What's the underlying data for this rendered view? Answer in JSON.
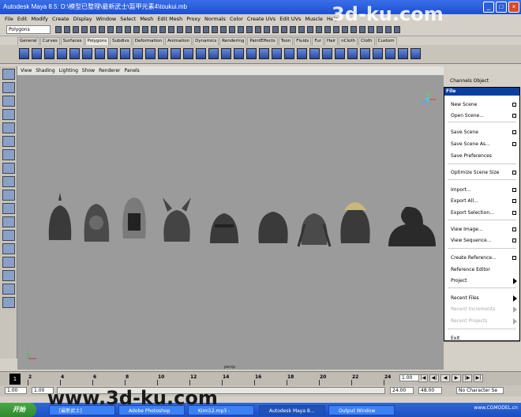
{
  "window": {
    "title": "Autodesk Maya 8.5: D:\\模型已整理\\最新武士\\盔甲元素4\\toukui.mb"
  },
  "menubar": [
    "File",
    "Edit",
    "Modify",
    "Create",
    "Display",
    "Window",
    "Select",
    "Mesh",
    "Edit Mesh",
    "Proxy",
    "Normals",
    "Color",
    "Create UVs",
    "Edit UVs",
    "Muscle",
    "Help"
  ],
  "mode": "Polygons",
  "shelf_tabs": [
    "General",
    "Curves",
    "Surfaces",
    "Polygons",
    "Subdivs",
    "Deformation",
    "Animation",
    "Dynamics",
    "Rendering",
    "PaintEffects",
    "Toon",
    "Fluids",
    "Fur",
    "Hair",
    "nCloth",
    "Cloth",
    "Custom"
  ],
  "viewport_menu": [
    "View",
    "Shading",
    "Lighting",
    "Show",
    "Renderer",
    "Panels"
  ],
  "viewport_label": "persp",
  "channel_box": "Channels Object",
  "file_menu": {
    "title": "File",
    "items": [
      {
        "label": "New Scene",
        "option": true
      },
      {
        "label": "Open Scene...",
        "option": true
      },
      {
        "label": "Save Scene",
        "option": true
      },
      {
        "label": "Save Scene As...",
        "option": true
      },
      {
        "label": "Save Preferences"
      },
      {
        "label": "Optimize Scene Size",
        "option": true
      },
      {
        "label": "Import...",
        "option": true
      },
      {
        "label": "Export All...",
        "option": true
      },
      {
        "label": "Export Selection...",
        "option": true
      },
      {
        "label": "View Image...",
        "option": true
      },
      {
        "label": "View Sequence...",
        "option": true
      },
      {
        "label": "Create Reference...",
        "option": true
      },
      {
        "label": "Reference Editor"
      },
      {
        "label": "Project",
        "submenu": true
      },
      {
        "label": "Recent Files",
        "submenu": true
      },
      {
        "label": "Recent Increments",
        "submenu": true,
        "disabled": true
      },
      {
        "label": "Recent Projects",
        "submenu": true,
        "disabled": true
      },
      {
        "label": "Exit"
      }
    ]
  },
  "timeline": {
    "frames": [
      "2",
      "4",
      "6",
      "8",
      "10",
      "12",
      "14",
      "16",
      "18",
      "20",
      "22",
      "24"
    ],
    "current_frame": "1",
    "current_time": "1.00",
    "start": "1.00",
    "range_start": "1.00",
    "range_end": "24.00",
    "end": "48.00",
    "character_set": "No Character Se"
  },
  "taskbar": {
    "start": "开始",
    "tasks": [
      "[最新武士]",
      "Adobe Photoshop",
      "Kimi12.mp3 -",
      "Autodesk Maya 8...",
      "Output Window"
    ],
    "tray": "www.CGMODEL.cn"
  },
  "watermarks": [
    "3d-ku.com",
    "www.3d-ku.com"
  ]
}
